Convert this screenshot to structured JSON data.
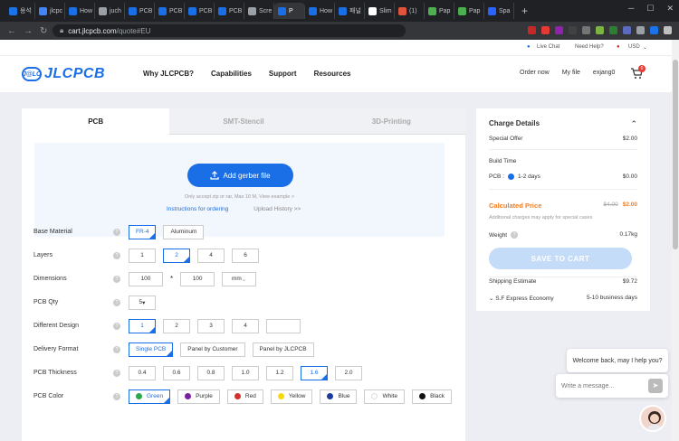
{
  "browser": {
    "tabs": [
      {
        "label": "용석",
        "color": "#1a73e8"
      },
      {
        "label": "jlcpc",
        "color": "#4285f4"
      },
      {
        "label": "How",
        "color": "#1a6ee6"
      },
      {
        "label": "juch",
        "color": "#9aa0a6"
      },
      {
        "label": "PCB",
        "color": "#1a6ee6"
      },
      {
        "label": "PCB",
        "color": "#1a6ee6"
      },
      {
        "label": "PCB",
        "color": "#1a6ee6"
      },
      {
        "label": "PCB",
        "color": "#1a6ee6"
      },
      {
        "label": "Scre",
        "color": "#9aa0a6"
      },
      {
        "label": "P",
        "color": "#1a6ee6"
      },
      {
        "label": "How",
        "color": "#1a6ee6"
      },
      {
        "label": "패널",
        "color": "#1a6ee6"
      },
      {
        "label": "Slim",
        "color": "#fff"
      },
      {
        "label": "(1)",
        "color": "#e0533d"
      },
      {
        "label": "Pap",
        "color": "#4caf50"
      },
      {
        "label": "Pap",
        "color": "#4caf50"
      },
      {
        "label": "Spa",
        "color": "#2962ff"
      }
    ],
    "url_host": "cart.jlcpcb.com",
    "url_path": "/quote#EU",
    "ext_colors": [
      "#c62828",
      "#e53935",
      "#8e24aa",
      "#424242",
      "#757575",
      "#7cb342",
      "#2e7d32",
      "#5c6bc0",
      "#9aa0a6",
      "#1a73e8",
      "#c0c0c0"
    ]
  },
  "topstrip": {
    "live_chat": "Live Chat",
    "need_help": "Need Help?",
    "currency": "USD"
  },
  "header": {
    "logo_badge": "J@LC",
    "logo_text": "JLCPCB",
    "nav": [
      "Why JLCPCB?",
      "Capabilities",
      "Support",
      "Resources"
    ],
    "right": [
      "Order now",
      "My file",
      "exjang0"
    ],
    "cart_count": "0"
  },
  "tabs": [
    "PCB",
    "SMT-Stencil",
    "3D-Printing"
  ],
  "upload": {
    "button": "Add gerber file",
    "hint": "Only accept zip or rar, Max 10 M, View example >",
    "link_instructions": "Instructions for ordering",
    "link_history": "Upload History >>"
  },
  "form": {
    "base_material": {
      "label": "Base Material",
      "options": [
        "FR-4",
        "Aluminum"
      ],
      "selected": 0
    },
    "layers": {
      "label": "Layers",
      "options": [
        "1",
        "2",
        "4",
        "6"
      ],
      "selected": 1
    },
    "dimensions": {
      "label": "Dimensions",
      "w": "100",
      "sep": "*",
      "h": "100",
      "unit": "mm"
    },
    "pcb_qty": {
      "label": "PCB Qty",
      "value": "5"
    },
    "different_design": {
      "label": "Different Design",
      "options": [
        "1",
        "2",
        "3",
        "4",
        ""
      ],
      "selected": 0
    },
    "delivery_format": {
      "label": "Delivery Format",
      "options": [
        "Single PCB",
        "Panel by Customer",
        "Panel by JLCPCB"
      ],
      "selected": 0
    },
    "pcb_thickness": {
      "label": "PCB Thickness",
      "options": [
        "0.4",
        "0.6",
        "0.8",
        "1.0",
        "1.2",
        "1.6",
        "2.0"
      ],
      "selected": 5
    },
    "pcb_color": {
      "label": "PCB Color",
      "options": [
        {
          "name": "Green",
          "color": "#2aa84a"
        },
        {
          "name": "Purple",
          "color": "#7b1fa2"
        },
        {
          "name": "Red",
          "color": "#d32f2f"
        },
        {
          "name": "Yellow",
          "color": "#f5d90a"
        },
        {
          "name": "Blue",
          "color": "#1a3c9c"
        },
        {
          "name": "White",
          "color": "#ffffff"
        },
        {
          "name": "Black",
          "color": "#111111"
        }
      ],
      "selected": 0
    }
  },
  "charge": {
    "title": "Charge Details",
    "special_offer": {
      "label": "Special Offer",
      "value": "$2.00"
    },
    "build_time": {
      "label": "Build Time"
    },
    "pcb": {
      "label": "PCB :",
      "option": "1-2 days",
      "value": "$0.00"
    },
    "calculated": {
      "label": "Calculated Price",
      "old": "$4.00",
      "new": "$2.00"
    },
    "note": "Additional charges may apply for special cases",
    "weight": {
      "label": "Weight",
      "value": "0.17kg"
    },
    "save_button": "SAVE TO CART",
    "shipping": {
      "label": "Shipping Estimate",
      "value": "$9.72"
    },
    "method": {
      "label": "S.F Express Economy",
      "value": "5-10 business days"
    }
  },
  "chat": {
    "welcome": "Welcome back, may I help you?",
    "placeholder": "Write a message..."
  }
}
